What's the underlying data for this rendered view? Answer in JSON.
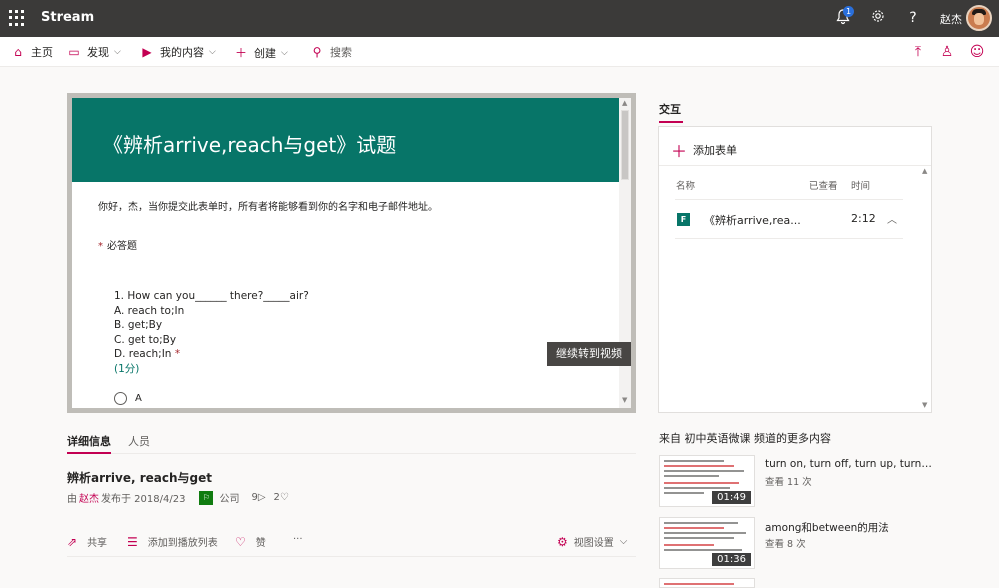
{
  "app": {
    "title": "Stream"
  },
  "topbar": {
    "notification_count": "1",
    "user_name": "赵杰"
  },
  "nav": {
    "items": [
      {
        "label": "主页",
        "icon": "home-icon"
      },
      {
        "label": "发现",
        "icon": "discover-icon"
      },
      {
        "label": "我的内容",
        "icon": "my-content-icon"
      },
      {
        "label": "创建",
        "icon": "plus-icon"
      }
    ],
    "search_placeholder": "搜索"
  },
  "form": {
    "title": "《辨析arrive,reach与get》试题",
    "intro": "你好，杰，当你提交此表单时，所有者将能够看到你的名字和电子邮件地址。",
    "required_note": "必答题",
    "question": "1. How can you______ there?_____air?",
    "options": [
      "A. reach to;In",
      "B. get;By",
      "C. get to;By",
      "D. reach;In"
    ],
    "score": "(1分)",
    "radio_first": "A",
    "accent_color": "#077568"
  },
  "continue_tooltip": "继续转到视频",
  "details": {
    "tabs": [
      "详细信息",
      "人员"
    ],
    "video_title": "辨析arrive, reach与get",
    "by_label": "由",
    "author": "赵杰",
    "published": "发布于 2018/4/23",
    "visibility": "公司",
    "views": "9",
    "likes": "2"
  },
  "actions": {
    "share": "共享",
    "add_playlist": "添加到播放列表",
    "like": "赞",
    "more": "···",
    "view_settings": "视图设置"
  },
  "interaction": {
    "title": "交互",
    "add_form": "添加表单",
    "headers": {
      "name": "名称",
      "viewed": "已查看",
      "time": "时间"
    },
    "rows": [
      {
        "name": "《辨析arrive,rea...",
        "time": "2:12"
      }
    ]
  },
  "more_from": {
    "title": "来自 初中英语微课 频道的更多内容",
    "items": [
      {
        "title": "turn on, turn off, turn up, turn do...",
        "views": "查看 11 次",
        "duration": "01:49"
      },
      {
        "title": "among和between的用法",
        "views": "查看 8 次",
        "duration": "01:36"
      }
    ]
  },
  "brand_color": "#c30052"
}
